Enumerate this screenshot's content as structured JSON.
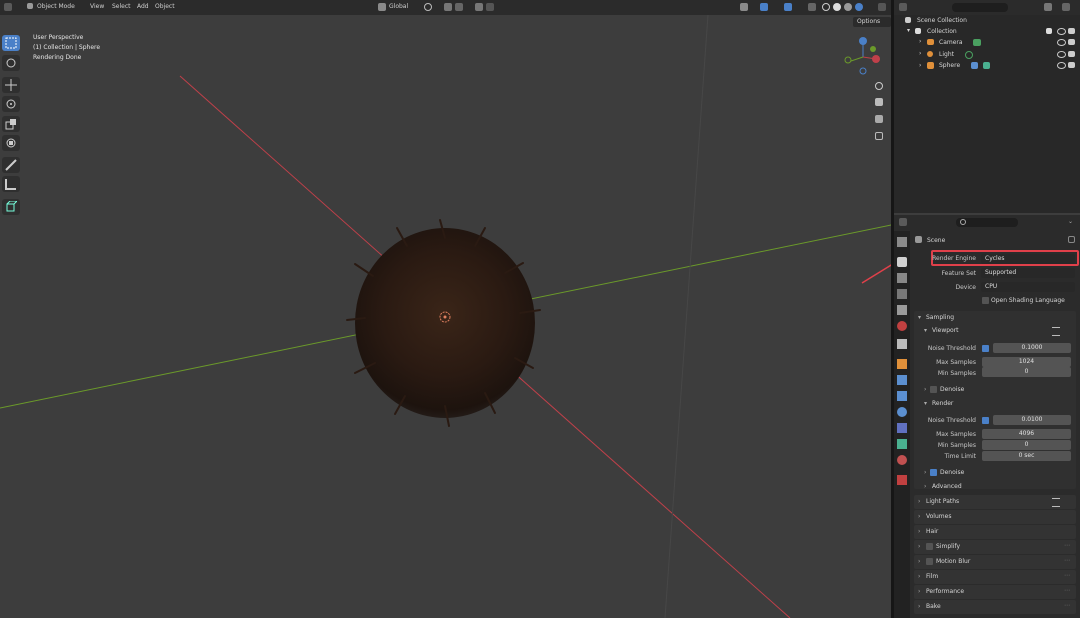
{
  "header": {
    "mode": "Object Mode",
    "menu": [
      "View",
      "Select",
      "Add",
      "Object"
    ],
    "transform": "Global",
    "options": "Options"
  },
  "viewport": {
    "overlay_lines": [
      "User Perspective",
      "(1) Collection | Sphere",
      "Rendering Done"
    ]
  },
  "outliner": {
    "title": "Scene Collection",
    "items": [
      "Collection",
      "Camera",
      "Light",
      "Sphere"
    ]
  },
  "properties": {
    "scene": "Scene",
    "render_engine_label": "Render Engine",
    "render_engine": "Cycles",
    "feature_set_label": "Feature Set",
    "feature_set": "Supported",
    "device_label": "Device",
    "device": "CPU",
    "osl_label": "Open Shading Language",
    "sampling": "Sampling",
    "viewport": "Viewport",
    "noise_threshold_label": "Noise Threshold",
    "viewport_noise_threshold": "0.1000",
    "max_samples_label": "Max Samples",
    "viewport_max_samples": "1024",
    "min_samples_label": "Min Samples",
    "viewport_min_samples": "0",
    "denoise": "Denoise",
    "render": "Render",
    "render_noise_threshold": "0.0100",
    "render_max_samples": "4096",
    "render_min_samples": "0",
    "time_limit_label": "Time Limit",
    "render_time_limit": "0 sec",
    "render_denoise": "Denoise",
    "advanced": "Advanced",
    "panels": [
      "Light Paths",
      "Volumes",
      "Hair",
      "Simplify",
      "Motion Blur",
      "Film",
      "Performance",
      "Bake"
    ]
  },
  "colors": {
    "highlight": "#e0404a",
    "accent": "#4a80c8",
    "x_axis": "#c0404a",
    "y_axis": "#6b9a2a"
  }
}
